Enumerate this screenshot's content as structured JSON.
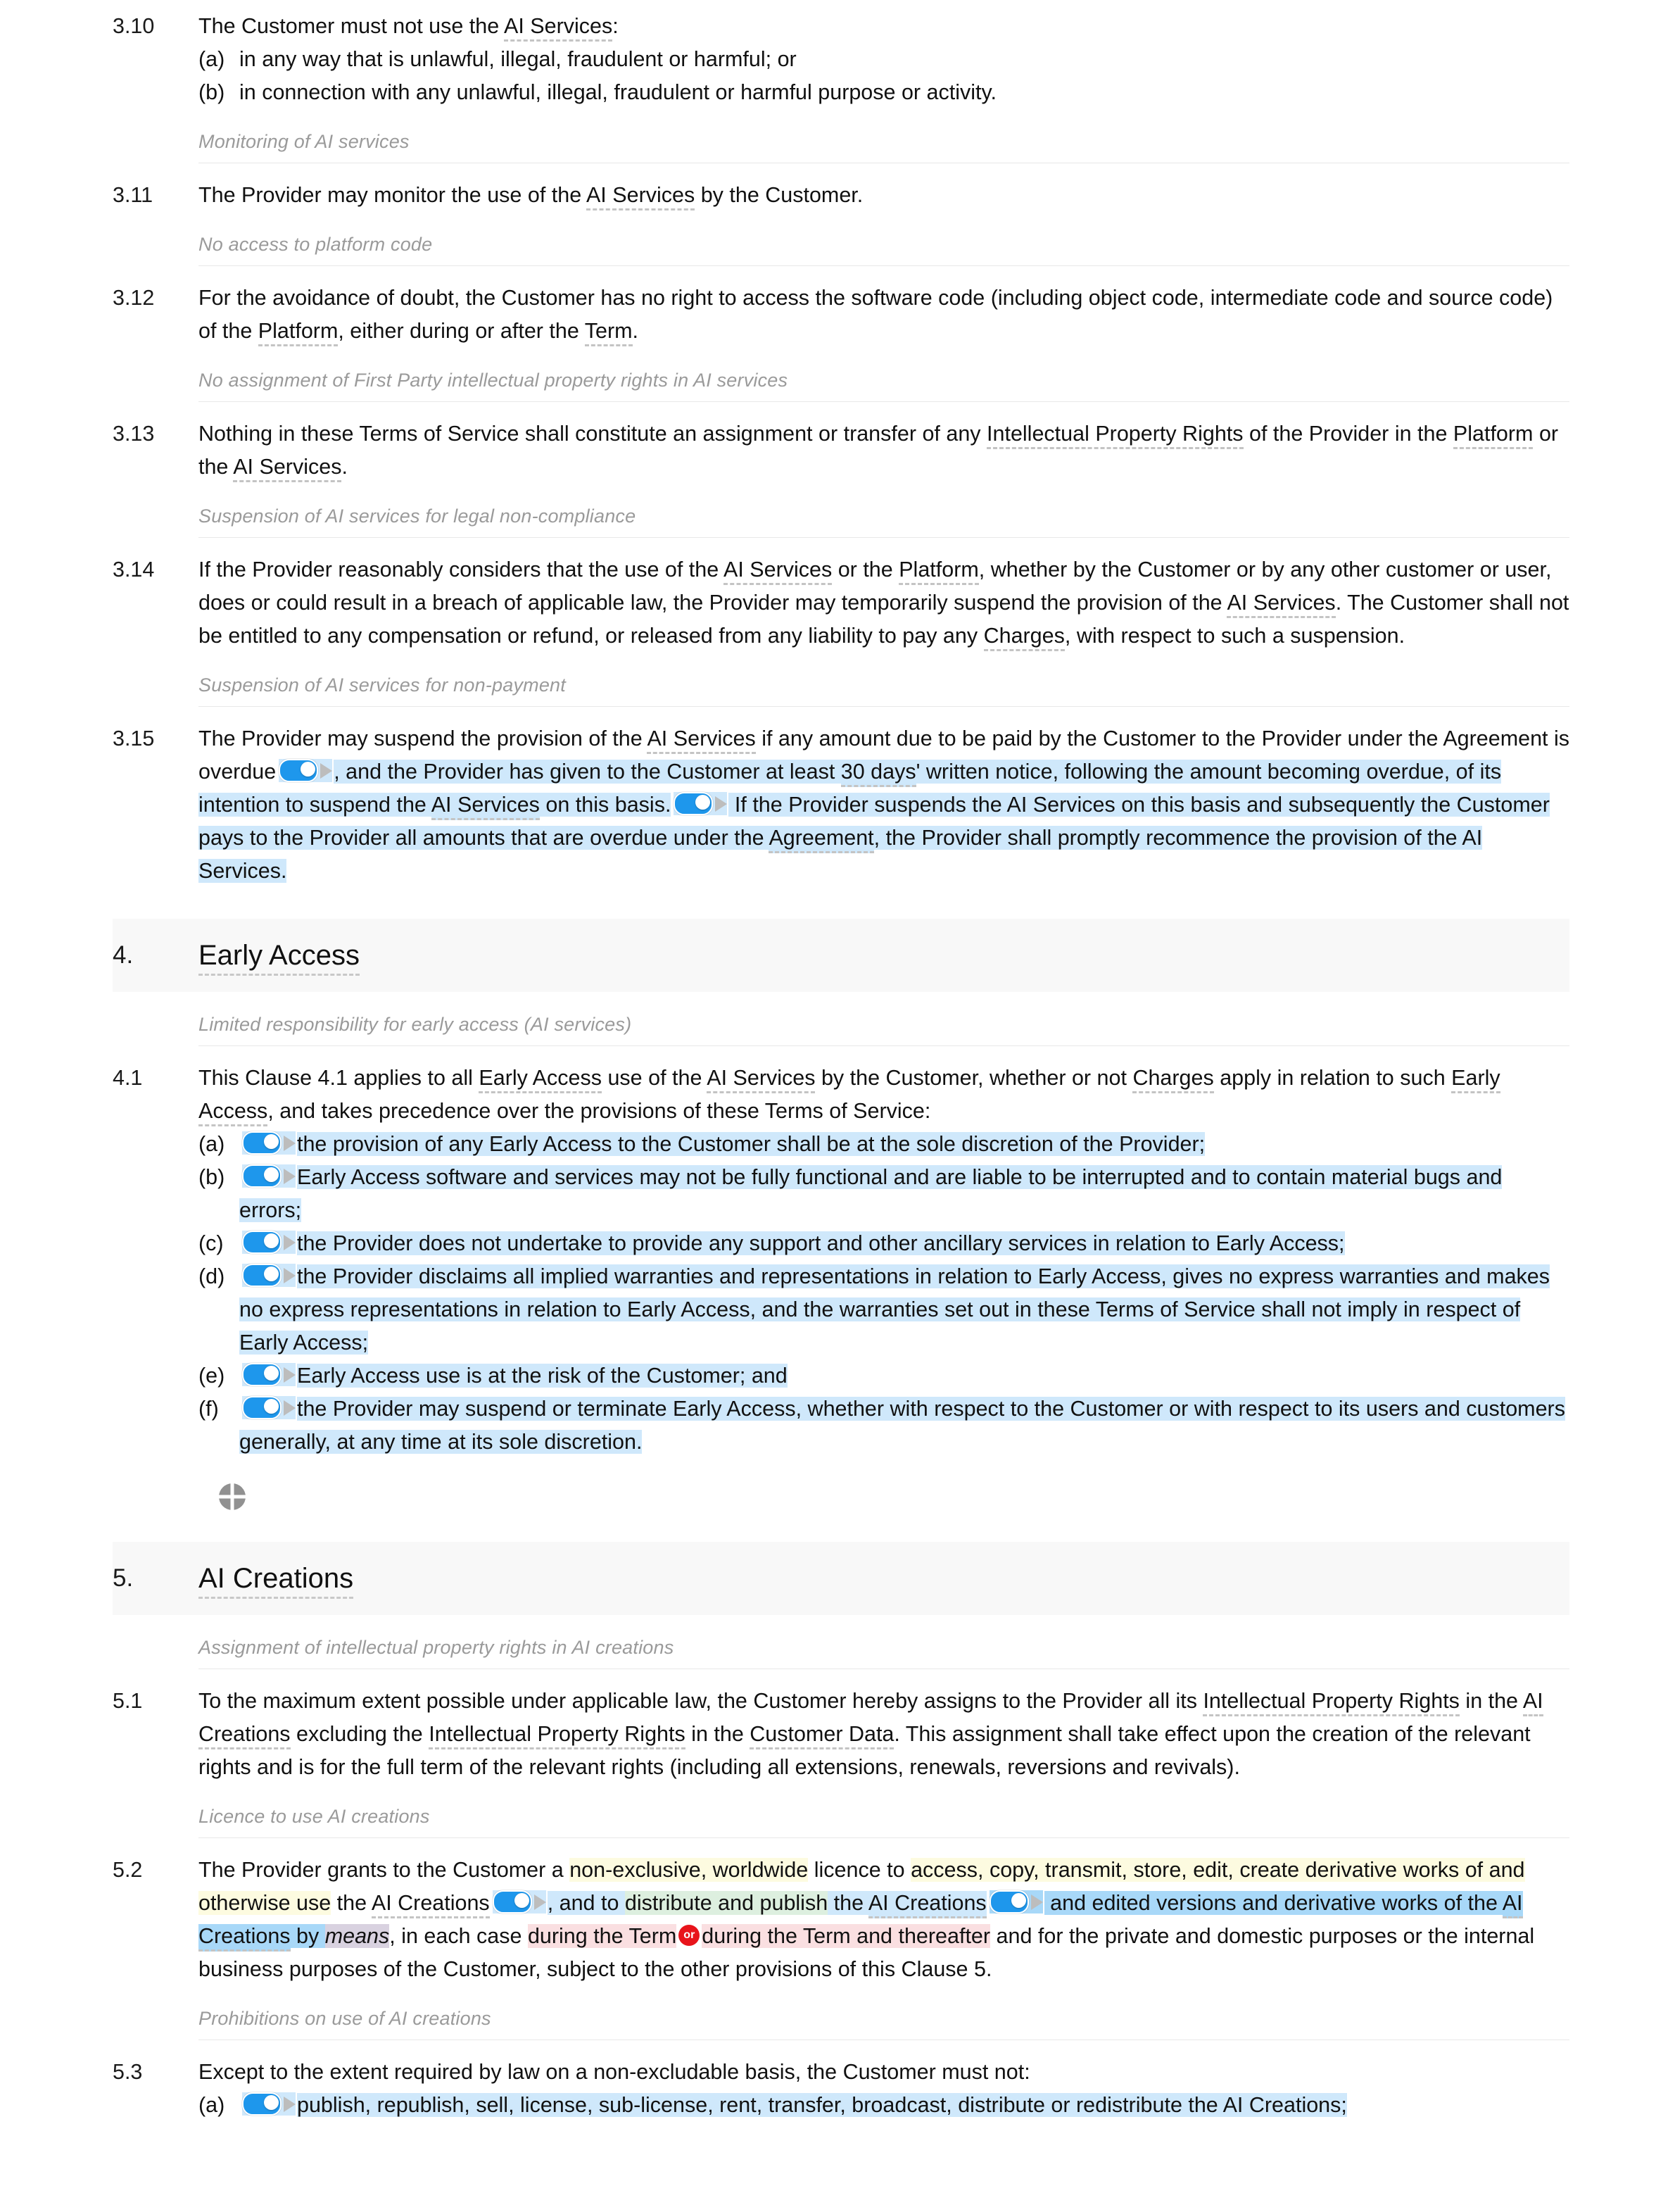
{
  "document": {
    "type": "terms-of-service-contract",
    "accent_colors": {
      "toggle_on": "#1e97ec",
      "or_badge": "#e8141b",
      "highlight_blue": "#cfe8fb",
      "highlight_blue_dark": "#a8d8f8",
      "highlight_yellow": "#fdfbe0",
      "highlight_green": "#ddefdf",
      "highlight_pink": "#fadfe1",
      "highlight_purple": "#d9d2e0",
      "defined_term_underline": "#c4c4c4",
      "section_band": "#f8f8f8"
    }
  },
  "clauses": {
    "c310": {
      "number": "3.10",
      "lead": "The Customer must not use the ",
      "term": "AI Services",
      "lead_end": ":",
      "items": [
        {
          "label": "(a)",
          "text": "in any way that is unlawful, illegal, fraudulent or harmful; or"
        },
        {
          "label": "(b)",
          "text": "in connection with any unlawful, illegal, fraudulent or harmful purpose or activity."
        }
      ]
    },
    "h_monitoring": "Monitoring of AI services",
    "c311": {
      "number": "3.11",
      "p1": "The Provider may monitor the use of the ",
      "term": "AI Services",
      "p2": " by the Customer."
    },
    "h_noaccess": "No access to platform code",
    "c312": {
      "number": "3.12",
      "p1": "For the avoidance of doubt, the Customer has no right to access the software code (including object code, intermediate code and source code) of the ",
      "term1": "Platform",
      "p2": ", either during or after the ",
      "term2": "Term",
      "p3": "."
    },
    "h_noassign": "No assignment of First Party intellectual property rights in AI services",
    "c313": {
      "number": "3.13",
      "p1": "Nothing in these Terms of Service shall constitute an assignment or transfer of any ",
      "term1": "Intellectual Property Rights",
      "p2": " of the Provider in the ",
      "term2": "Platform",
      "p3": " or the ",
      "term3": "AI Services",
      "p4": "."
    },
    "h_suspend_legal": "Suspension of AI services for legal non-compliance",
    "c314": {
      "number": "3.14",
      "p1": "If the Provider reasonably considers that the use of the ",
      "term1": "AI Services",
      "p2": " or the ",
      "term2": "Platform",
      "p3": ", whether by the Customer or by any other customer or user, does or could result in a breach of applicable law, the Provider may temporarily suspend the provision of the ",
      "term3": "AI Services",
      "p4": ". The Customer shall not be entitled to any compensation or refund, or released from any liability to pay any ",
      "term4": "Charges",
      "p5": ", with respect to such a suspension."
    },
    "h_suspend_nonpay": "Suspension of AI services for non-payment",
    "c315": {
      "number": "3.15",
      "p1": "The Provider may suspend the provision of the ",
      "term1": "AI Services",
      "p2": " if any amount due to be paid by the Customer to the Provider under the Agreement is overdue",
      "opt1": ", and the Provider has given to the Customer at least ",
      "days": "30 days",
      "opt2": "' written notice, following the amount becoming overdue, of its intention to suspend the ",
      "term2": "AI Services",
      "opt3": " on this basis.",
      "opt4": " If the Provider suspends the AI Services on this basis and subsequently the Customer pays to the Provider all amounts that are overdue under the ",
      "term3": "Agreement",
      "opt5": ", the Provider shall promptly recommence the provision of the AI Services."
    }
  },
  "section4": {
    "number": "4.",
    "title": "Early Access",
    "subhead": "Limited responsibility for early access (AI services)",
    "c41": {
      "number": "4.1",
      "p1": "This Clause 4.1 applies to all ",
      "term1": "Early Access",
      "p2": " use of the ",
      "term2": "AI Services",
      "p3": " by the Customer, whether or not ",
      "term3": "Charges",
      "p4": " apply in relation to such ",
      "term4": "Early Access",
      "p5": ", and takes precedence over the provisions of these Terms of Service:",
      "items": [
        {
          "label": "(a)",
          "text": "the provision of any Early Access to the Customer shall be at the sole discretion of the Provider;",
          "toggle": true
        },
        {
          "label": "(b)",
          "text": "Early Access software and services may not be fully functional and are liable to be interrupted and to contain material bugs and errors;",
          "toggle": true
        },
        {
          "label": "(c)",
          "text": "the Provider does not undertake to provide any support and other ancillary services in relation to Early Access;",
          "toggle": true
        },
        {
          "label": "(d)",
          "text": "the Provider disclaims all implied warranties and representations in relation to Early Access, gives no express warranties and makes no express representations in relation to Early Access, and the warranties set out in these Terms of Service shall not imply in respect of Early Access;",
          "toggle": true
        },
        {
          "label": "(e)",
          "text": "Early Access use is at the risk of the Customer; and",
          "toggle": true
        },
        {
          "label": "(f)",
          "text": "the Provider may suspend or terminate Early Access, whether with respect to the Customer or with respect to its users and customers generally, at any time at its sole discretion.",
          "toggle": true
        }
      ]
    }
  },
  "quadrant_icon": "quadrant-move-handle",
  "section5": {
    "number": "5.",
    "title": "AI Creations",
    "subhead1": "Assignment of intellectual property rights in AI creations",
    "c51": {
      "number": "5.1",
      "p1": "To the maximum extent possible under applicable law, the Customer hereby assigns to the Provider all its ",
      "term1": "Intellectual Property Rights",
      "p2": " in the ",
      "term2": "AI Creations",
      "p3": " excluding the ",
      "term3": "Intellectual Property Rights",
      "p4": " in the ",
      "term4": "Customer Data",
      "p5": ". This assignment shall take effect upon the creation of the relevant rights and is for the full term of the relevant rights (including all extensions, renewals, reversions and revivals)."
    },
    "subhead2": "Licence to use AI creations",
    "c52": {
      "number": "5.2",
      "p1": "The Provider grants to the Customer a ",
      "y1": "non-exclusive, worldwide",
      "p2": " licence to ",
      "y2": "access, copy, transmit, store, edit, create derivative works of and otherwise use",
      "p3": " the ",
      "term1": "AI Creations",
      "p4": ", and to ",
      "g1": "distribute and publish",
      "p5": " the ",
      "term2": "AI Creations",
      "p6": " and edited versions and derivative works of the ",
      "term3": "AI Creations",
      "p7": " by ",
      "means": "means",
      "p8": ", in each case ",
      "pk1": "during the Term",
      "or_label": "or",
      "pk2": "during the Term and thereafter",
      "p9": " and for the private and domestic purposes or the internal business purposes of the Customer, subject to the other provisions of this Clause 5."
    },
    "subhead3": "Prohibitions on use of AI creations",
    "c53": {
      "number": "5.3",
      "p1": "Except to the extent required by law on a non-excludable basis, the Customer must not:",
      "items": [
        {
          "label": "(a)",
          "text": "publish, republish, sell, license, sub-license, rent, transfer, broadcast, distribute or redistribute the AI Creations;",
          "toggle": true
        }
      ]
    }
  }
}
